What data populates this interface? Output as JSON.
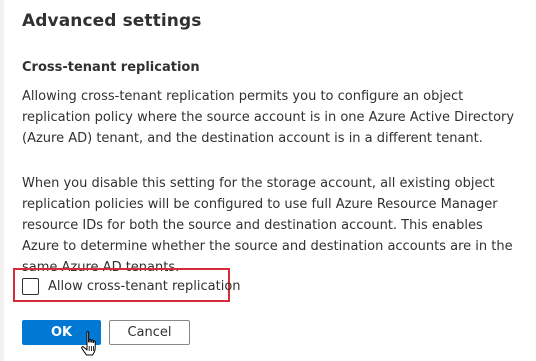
{
  "panel": {
    "title": "Advanced settings",
    "section_heading": "Cross-tenant replication",
    "paragraph_1": "Allowing cross-tenant replication permits you to configure an object replication policy where the source account is in one Azure Active Directory (Azure AD) tenant, and the destination account is in a different tenant.",
    "paragraph_2": "When you disable this setting for the storage account, all existing object replication policies will be configured to use full Azure Resource Manager resource IDs for both the source and destination account. This enables Azure to determine whether the source and destination accounts are in the same Azure AD tenants."
  },
  "checkbox": {
    "label": "Allow cross-tenant replication",
    "checked": false
  },
  "buttons": {
    "ok_label": "OK",
    "cancel_label": "Cancel"
  },
  "colors": {
    "primary": "#0078d4",
    "highlight": "#d82b3a",
    "text": "#323130"
  },
  "icons": {
    "cursor": "hand-pointer-icon"
  }
}
